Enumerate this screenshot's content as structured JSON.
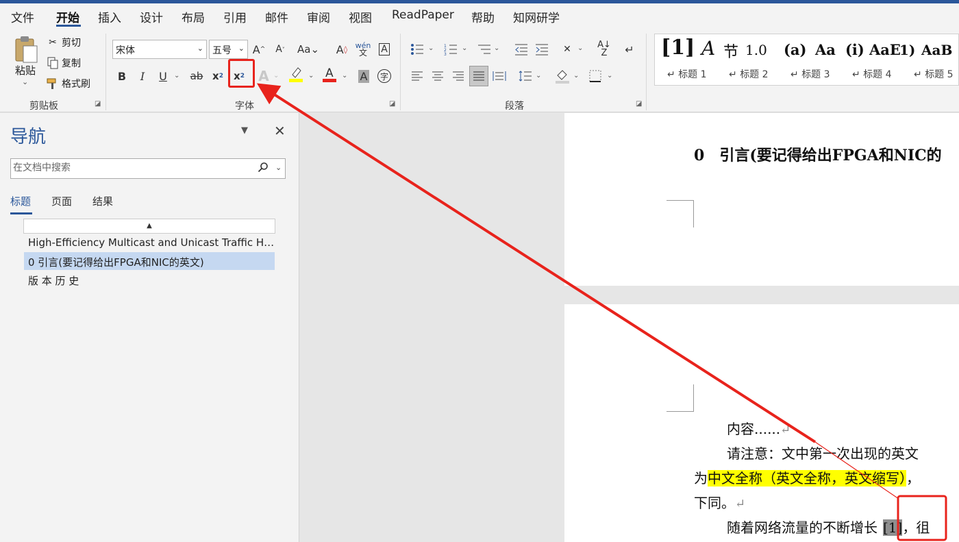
{
  "tabs": [
    {
      "label": "文件",
      "active": false
    },
    {
      "label": "开始",
      "active": true
    },
    {
      "label": "插入",
      "active": false
    },
    {
      "label": "设计",
      "active": false
    },
    {
      "label": "布局",
      "active": false
    },
    {
      "label": "引用",
      "active": false
    },
    {
      "label": "邮件",
      "active": false
    },
    {
      "label": "审阅",
      "active": false
    },
    {
      "label": "视图",
      "active": false
    },
    {
      "label": "ReadPaper",
      "active": false
    },
    {
      "label": "帮助",
      "active": false
    },
    {
      "label": "知网研学",
      "active": false
    }
  ],
  "ribbon": {
    "clipboard": {
      "paste_label": "粘贴",
      "cut_label": "剪切",
      "copy_label": "复制",
      "format_painter_label": "格式刷",
      "group_label": "剪贴板"
    },
    "font": {
      "font_name": "宋体",
      "font_size": "五号",
      "group_label": "字体",
      "highlight_color": "#ffff00",
      "font_color": "#e8231c",
      "highlighted_button": "superscript"
    },
    "paragraph": {
      "group_label": "段落"
    },
    "styles": [
      {
        "glyph": "[1]",
        "name": "标题 1"
      },
      {
        "glyph": "节",
        "name": "标题 2"
      },
      {
        "glyph": "1.0",
        "name": "标题 3"
      },
      {
        "glyph": "(a)",
        "name": "标题 4"
      },
      {
        "glyph": "Aa",
        "name": "标题 5"
      }
    ]
  },
  "nav": {
    "title": "导航",
    "search_placeholder": "在文档中搜索",
    "tabs": [
      {
        "label": "标题",
        "active": true
      },
      {
        "label": "页面",
        "active": false
      },
      {
        "label": "结果",
        "active": false
      }
    ],
    "items": [
      {
        "label": "High-Efficiency Multicast and Unicast Traffic Ha...",
        "selected": false
      },
      {
        "label": "0 引言(要记得给出FPGA和NIC的英文)",
        "selected": true
      },
      {
        "label": "版 本 历 史",
        "selected": false
      }
    ]
  },
  "document": {
    "heading_number": "0",
    "heading_text": "引言(要记得给出FPGA和NIC的",
    "para1": "内容......",
    "para2_start": "请注意：文中第一次出现的英文",
    "para3_prefix": "为",
    "para3_highlight": "中文全称（英文全称，英文缩写）",
    "para3_suffix": "，",
    "para4": "下同。",
    "para5_start": "随着网络流量的不断增长",
    "para5_cite": "[1]",
    "para5_end": "，徂",
    "para_mark": "↵"
  },
  "annotation": {
    "color": "#e8231c"
  }
}
